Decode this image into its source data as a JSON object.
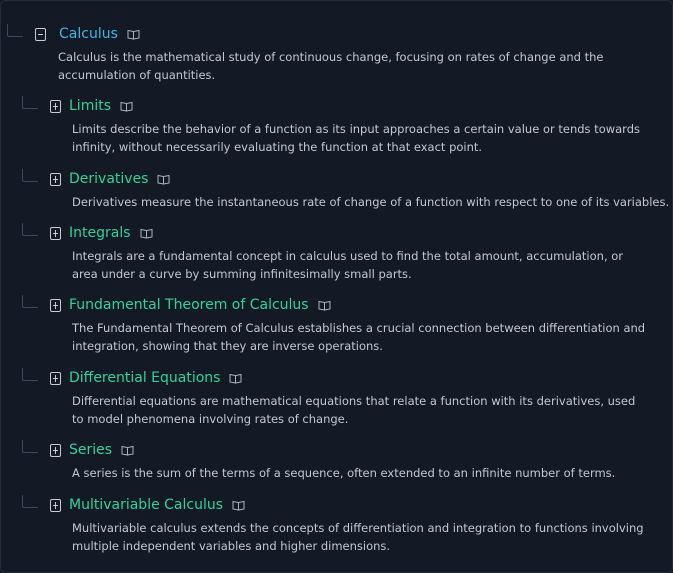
{
  "root": {
    "title": "Calculus",
    "description": "Calculus is the mathematical study of continuous change, focusing on rates of change and the accumulation of quantities."
  },
  "children": [
    {
      "title": "Limits",
      "description": "Limits describe the behavior of a function as its input approaches a certain value or tends towards infinity, without necessarily evaluating the function at that exact point."
    },
    {
      "title": "Derivatives",
      "description": "Derivatives measure the instantaneous rate of change of a function with respect to one of its variables."
    },
    {
      "title": "Integrals",
      "description": "Integrals are a fundamental concept in calculus used to find the total amount, accumulation, or area under a curve by summing infinitesimally small parts."
    },
    {
      "title": "Fundamental Theorem of Calculus",
      "description": "The Fundamental Theorem of Calculus establishes a crucial connection between differentiation and integration, showing that they are inverse operations."
    },
    {
      "title": "Differential Equations",
      "description": "Differential equations are mathematical equations that relate a function with its derivatives, used to model phenomena involving rates of change."
    },
    {
      "title": "Series",
      "description": "A series is the sum of the terms of a sequence, often extended to an infinite number of terms."
    },
    {
      "title": "Multivariable Calculus",
      "description": "Multivariable calculus extends the concepts of differentiation and integration to functions involving multiple independent variables and higher dimensions."
    }
  ],
  "icons": {
    "collapse": "minus-square-icon",
    "expand": "plus-square-icon",
    "info": "open-book-icon"
  },
  "colors": {
    "root_title": "#3fb6e6",
    "child_title": "#2fd39a",
    "background": "#131a25"
  }
}
